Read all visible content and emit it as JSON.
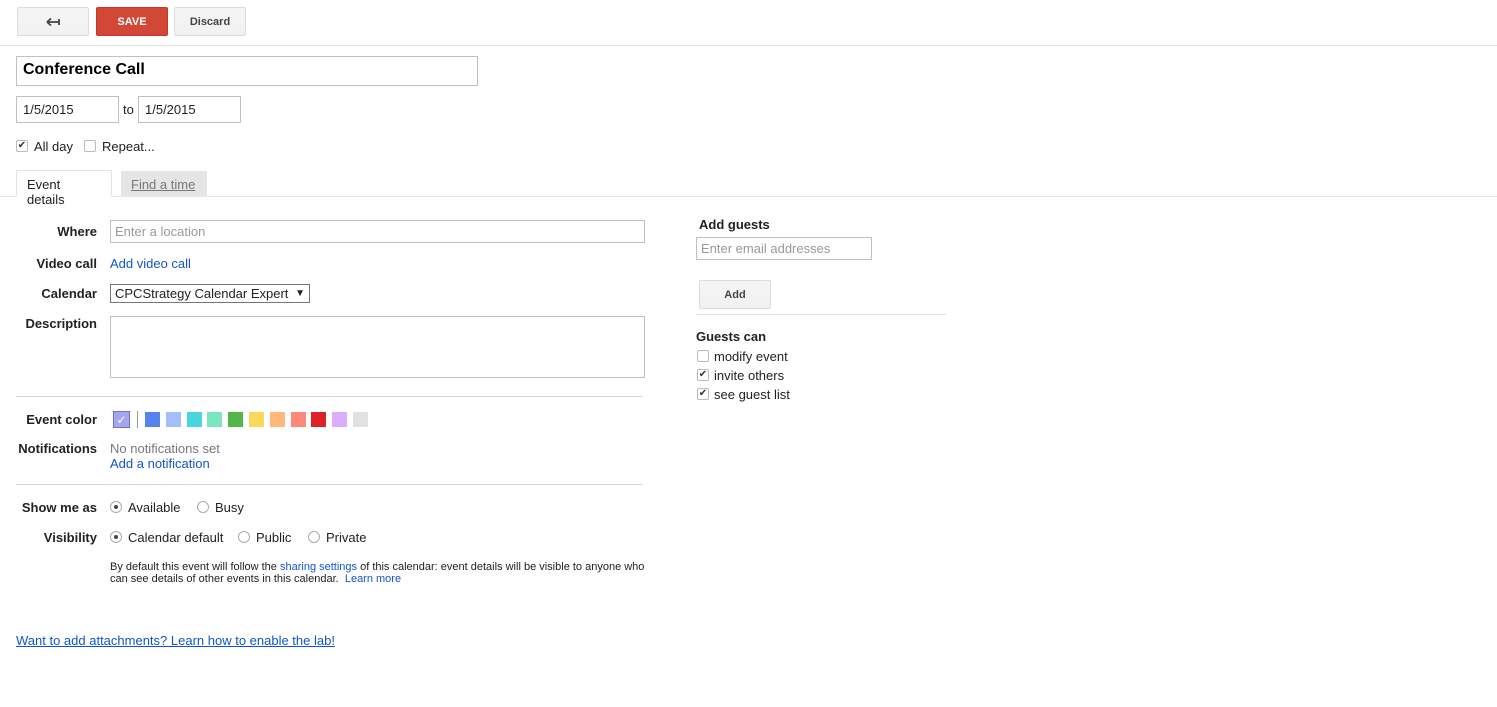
{
  "toolbar": {
    "back_icon": "back-arrow-icon",
    "save_label": "SAVE",
    "discard_label": "Discard"
  },
  "event": {
    "title": "Conference Call",
    "start_date": "1/5/2015",
    "to_label": "to",
    "end_date": "1/5/2015",
    "all_day_label": "All day",
    "all_day_checked": true,
    "repeat_label": "Repeat...",
    "repeat_checked": false
  },
  "tabs": [
    {
      "label": "Event details",
      "active": true
    },
    {
      "label": "Find a time",
      "active": false
    }
  ],
  "details": {
    "where_label": "Where",
    "where_placeholder": "Enter a location",
    "video_label": "Video call",
    "video_link": "Add video call",
    "calendar_label": "Calendar",
    "calendar_value": "CPCStrategy Calendar Expert",
    "description_label": "Description",
    "color_label": "Event color",
    "colors": [
      "#5484ed",
      "#a4bdfc",
      "#46d6db",
      "#7ae7bf",
      "#51b749",
      "#fbd75b",
      "#ffb878",
      "#ff887c",
      "#dc2127",
      "#dbadff",
      "#e1e1e1"
    ],
    "selected_color": "#a4a6f0",
    "notifications_label": "Notifications",
    "no_notifications": "No notifications set",
    "add_notification": "Add a notification",
    "show_me_as_label": "Show me as",
    "show_available": "Available",
    "show_busy": "Busy",
    "visibility_label": "Visibility",
    "vis_default": "Calendar default",
    "vis_public": "Public",
    "vis_private": "Private",
    "note_prefix": "By default this event will follow the ",
    "note_link": "sharing settings",
    "note_suffix": " of this calendar: event details will be visible to anyone who can see details of other events in this calendar.",
    "note_learn_more": "Learn more"
  },
  "guests": {
    "title": "Add guests",
    "input_placeholder": "Enter email addresses",
    "add_label": "Add",
    "guests_can_label": "Guests can",
    "options": [
      {
        "label": "modify event",
        "checked": false
      },
      {
        "label": "invite others",
        "checked": true
      },
      {
        "label": "see guest list",
        "checked": true
      }
    ]
  },
  "footer": {
    "lab_link": "Want to add attachments? Learn how to enable the lab!"
  }
}
